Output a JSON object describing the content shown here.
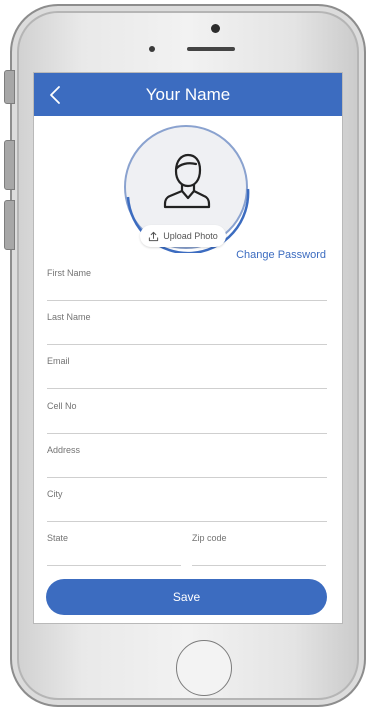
{
  "appbar": {
    "title": "Your Name"
  },
  "profile": {
    "upload_label": "Upload Photo"
  },
  "links": {
    "change_password": "Change Password"
  },
  "form": {
    "first_name_label": "First Name",
    "last_name_label": "Last Name",
    "email_label": "Email",
    "cell_label": "Cell No",
    "address_label": "Address",
    "city_label": "City",
    "state_label": "State",
    "zip_label": "Zip code"
  },
  "actions": {
    "save_label": "Save"
  },
  "colors": {
    "accent": "#3c6cc0"
  }
}
